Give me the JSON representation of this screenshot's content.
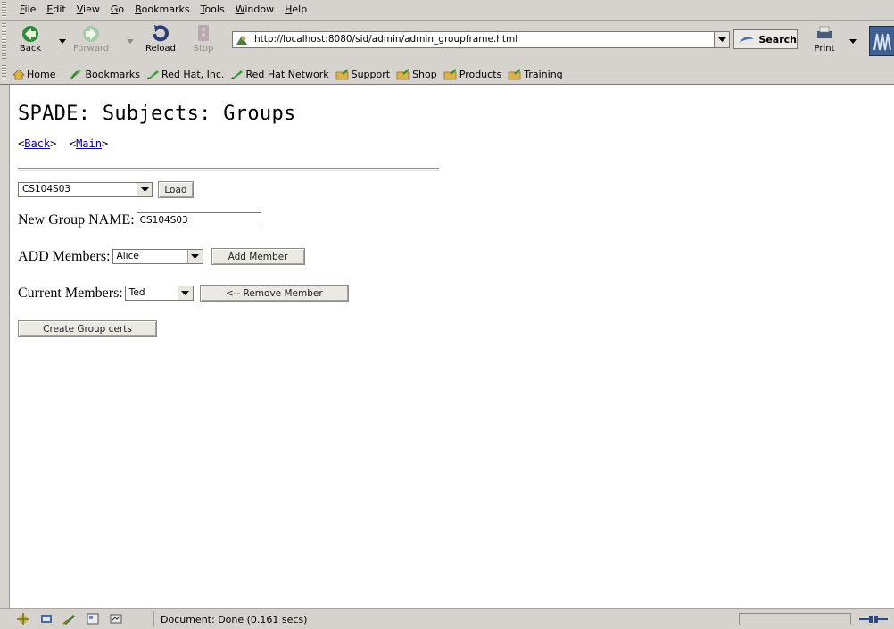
{
  "menubar": {
    "items": [
      "File",
      "Edit",
      "View",
      "Go",
      "Bookmarks",
      "Tools",
      "Window",
      "Help"
    ]
  },
  "navbar": {
    "back_label": "Back",
    "forward_label": "Forward",
    "reload_label": "Reload",
    "stop_label": "Stop",
    "url": "http://localhost:8080/sid/admin/admin_groupframe.html",
    "search_label": "Search",
    "print_label": "Print"
  },
  "personal_toolbar": {
    "items": [
      "Home",
      "Bookmarks",
      "Red Hat, Inc.",
      "Red Hat Network",
      "Support",
      "Shop",
      "Products",
      "Training"
    ]
  },
  "page": {
    "title": "SPADE: Subjects: Groups",
    "back_link": "Back",
    "main_link": "Main",
    "group_select_value": "CS104S03",
    "load_label": "Load",
    "new_group_label": "New Group NAME:",
    "new_group_value": "CS104S03",
    "add_members_label": "ADD Members:",
    "add_members_value": "Alice",
    "add_member_button": "Add Member",
    "current_members_label": "Current Members:",
    "current_members_value": "Ted",
    "remove_member_button": "<-- Remove Member",
    "create_certs_button": "Create Group certs"
  },
  "statusbar": {
    "text": "Document: Done (0.161 secs)"
  },
  "colors": {
    "chrome": "#d6d3ce",
    "link": "#00008b",
    "content_bg": "#ffffff"
  }
}
